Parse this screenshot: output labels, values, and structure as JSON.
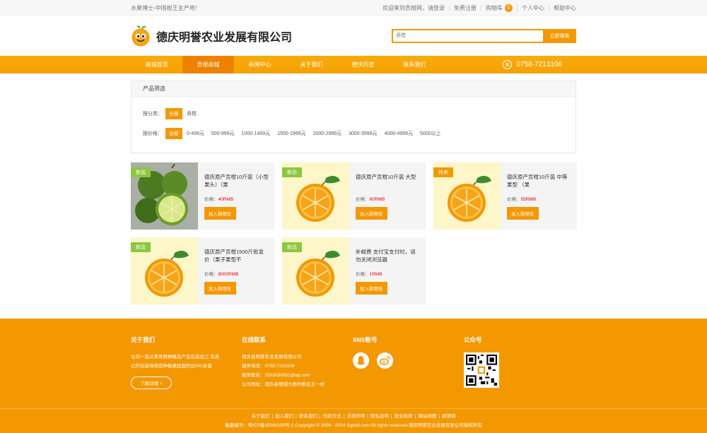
{
  "topbar": {
    "slogan": "水果博士-中国柑王主产地！",
    "welcome": "欢迎来到贡柑网，请登录",
    "register": "免费注册",
    "cart": "购物车",
    "cart_count": "0",
    "user_center": "个人中心",
    "help": "帮助中心"
  },
  "header": {
    "company": "德庆明誉农业发展有限公司",
    "search_placeholder": "贡柑",
    "search_button": "立即搜索"
  },
  "nav": {
    "items": [
      "商城首页",
      "贡柑商城",
      "新闻中心",
      "关于我们",
      "德庆历史",
      "联系我们"
    ],
    "active_index": 1,
    "phone": "0758-7213106"
  },
  "filter": {
    "title": "产品筛选",
    "category_label": "按分类：",
    "category_all": "全部",
    "categories": [
      "贡柑"
    ],
    "price_label": "按价格：",
    "price_all": "全部",
    "prices": [
      "0-499元",
      "500-999元",
      "1000-1499元",
      "1500-1999元",
      "2000-2999元",
      "3000-3999元",
      "4000-4999元",
      "5000以上"
    ]
  },
  "products": [
    {
      "badge": "新品",
      "badge_type": "new",
      "image": "lemon",
      "name": "德庆原产贡柑10斤装（小型果头）（果",
      "price_label": "价格：",
      "price": "40RMB",
      "button": "加入购物车"
    },
    {
      "badge": "新品",
      "badge_type": "new",
      "image": "orange",
      "name": "德庆原产贡柑10斤装 大型",
      "price_label": "价格：",
      "price": "60RMB",
      "button": "加入购物车"
    },
    {
      "badge": "热卖",
      "badge_type": "hot",
      "image": "orange",
      "name": "德庆原产贡柑10斤装 中等果型 （果",
      "price_label": "价格：",
      "price": "55RMB",
      "button": "加入购物车"
    },
    {
      "badge": "新品",
      "badge_type": "new",
      "image": "orange",
      "name": "德庆原产贡柑1500斤批发价（果子果型不",
      "price_label": "价格：",
      "price": "8000RMB",
      "button": "加入购物车"
    },
    {
      "badge": "新品",
      "badge_type": "new",
      "image": "orange",
      "name": "补邮费 支付宝支付时，请勿关闭浏览器",
      "price_label": "价格：",
      "price": "1RMB",
      "button": "加入购物车"
    }
  ],
  "footer": {
    "about_title": "关于我们",
    "about_text": "公司一直从事贡柑种植及产品包装加工 有自己的包装场地及种植果园面积达500多亩",
    "about_more": "了解详情 +",
    "contact_title": "在线联系",
    "contact_lines": [
      "德庆县明誉农业发展有限公司",
      "服务电话：0758-7213106",
      "服务联系：2502030051@qq.com",
      "公司地址：德庆县德城大桥村委会五一村"
    ],
    "sns_title": "SNS账号",
    "wechat_title": "公众号",
    "links": [
      "关于我们",
      "加入我们",
      "联系我们",
      "付款方式",
      "法律声明",
      "隐私说明",
      "营业执照",
      "网站地图",
      "经销商"
    ],
    "copyright": "备案编号：粤ICP备15080195号-1 Copyright © 2006 - 2014 Sgbs8.com All rights reserved.德庆明誉农业发展有限公司版权所有"
  }
}
